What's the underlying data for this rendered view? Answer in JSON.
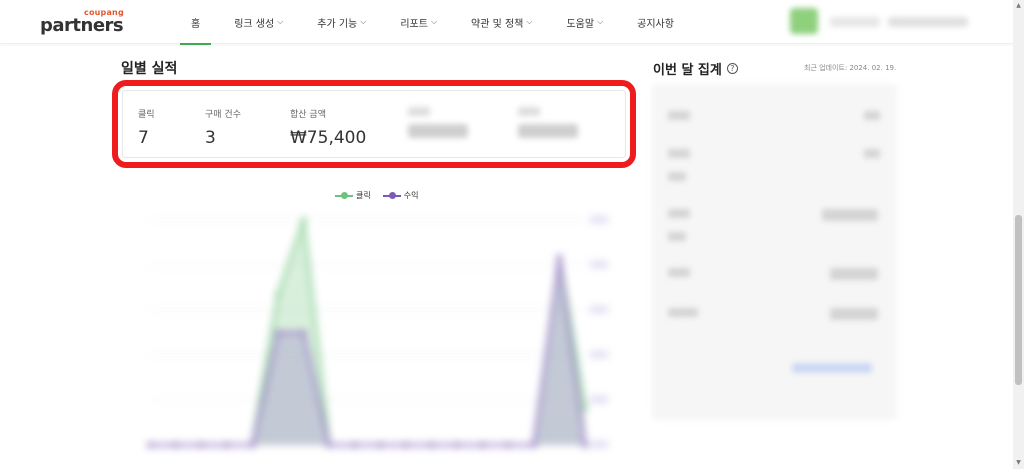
{
  "header": {
    "logo_small": "coupang",
    "logo_big": "partners",
    "nav": [
      {
        "label": "홈",
        "has_dropdown": false,
        "active": true
      },
      {
        "label": "링크 생성",
        "has_dropdown": true,
        "active": false
      },
      {
        "label": "추가 기능",
        "has_dropdown": true,
        "active": false
      },
      {
        "label": "리포트",
        "has_dropdown": true,
        "active": false
      },
      {
        "label": "약관 및 정책",
        "has_dropdown": true,
        "active": false
      },
      {
        "label": "도움말",
        "has_dropdown": true,
        "active": false
      },
      {
        "label": "공지사항",
        "has_dropdown": false,
        "active": false
      }
    ]
  },
  "daily": {
    "title": "일별 실적",
    "stats": [
      {
        "label": "클릭",
        "value": "7"
      },
      {
        "label": "구매 건수",
        "value": "3"
      },
      {
        "label": "합산 금액",
        "value": "₩75,400"
      }
    ],
    "legend": [
      {
        "label": "클릭",
        "color": "#6cc47c"
      },
      {
        "label": "수익",
        "color": "#7c5bb6"
      }
    ],
    "highlight_color": "#ee1c1c"
  },
  "monthly": {
    "title": "이번 달 집계",
    "updated": "최근 업데이트: 2024. 02. 19."
  },
  "chart_data": {
    "type": "line",
    "series": [
      {
        "name": "클릭",
        "values": [
          0,
          0,
          0,
          0,
          0,
          4,
          6,
          0,
          0,
          0,
          0,
          0,
          0,
          0,
          0,
          0,
          5,
          1
        ]
      },
      {
        "name": "수익",
        "values": [
          0,
          0,
          0,
          0,
          0,
          3,
          3,
          0,
          0,
          0,
          0,
          0,
          0,
          0,
          0,
          0,
          5,
          0
        ]
      }
    ],
    "colors": [
      "#6cc47c",
      "#7c5bb6"
    ]
  }
}
